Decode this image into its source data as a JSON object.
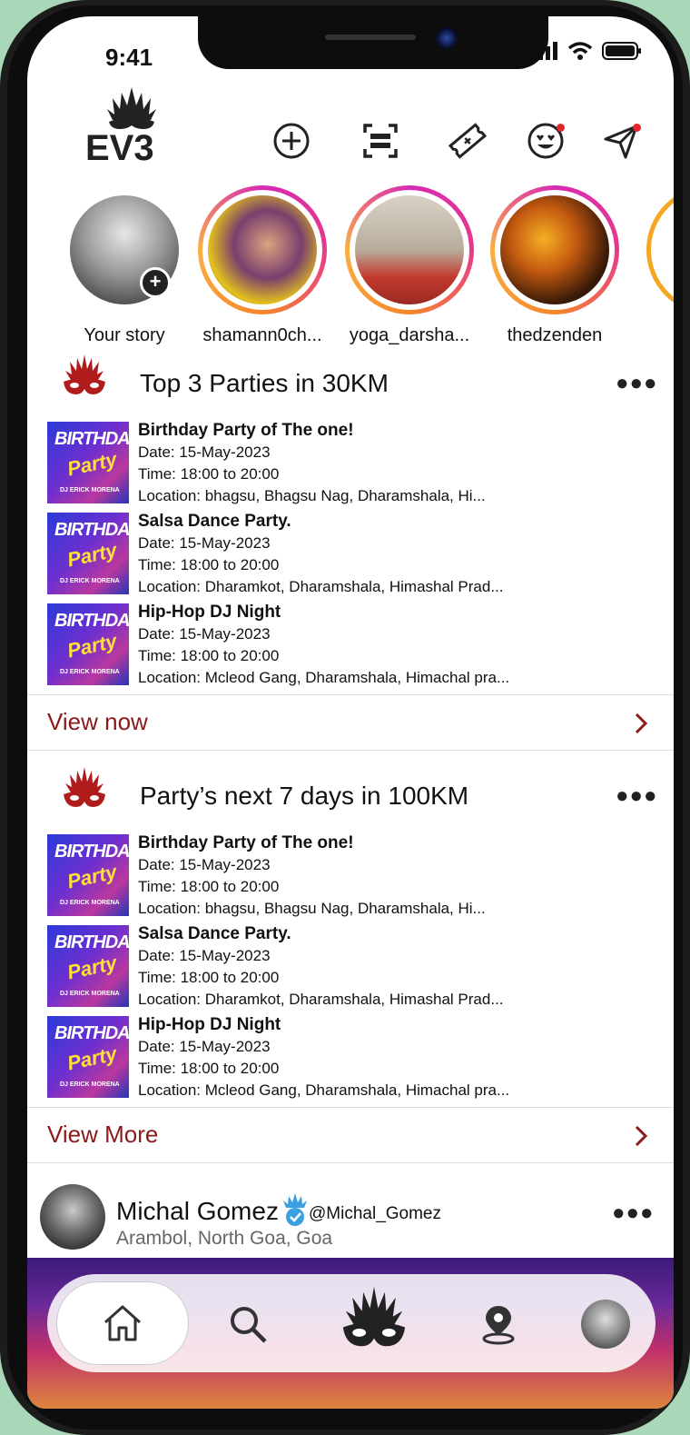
{
  "status": {
    "time": "9:41"
  },
  "app": {
    "logo_text": "EV3"
  },
  "stories": [
    {
      "label": "Your story",
      "is_own": true
    },
    {
      "label": "shamann0ch..."
    },
    {
      "label": "yoga_darsha..."
    },
    {
      "label": "thedzenden"
    }
  ],
  "sections": [
    {
      "title": "Top 3 Parties in 30KM",
      "events": [
        {
          "title": "Birthday Party of The one!",
          "date": "Date: 15-May-2023",
          "time": "Time: 18:00 to 20:00",
          "location": "Location: bhagsu, Bhagsu Nag, Dharamshala, Hi..."
        },
        {
          "title": "Salsa Dance Party.",
          "date": "Date: 15-May-2023",
          "time": "Time: 18:00 to 20:00",
          "location": "Location: Dharamkot, Dharamshala, Himashal Prad..."
        },
        {
          "title": "Hip-Hop DJ Night",
          "date": "Date: 15-May-2023",
          "time": "Time: 18:00 to 20:00",
          "location": "Location: Mcleod Gang, Dharamshala, Himachal pra..."
        }
      ],
      "action_label": "View now"
    },
    {
      "title": "Party’s next 7 days in 100KM",
      "events": [
        {
          "title": "Birthday Party of The one!",
          "date": "Date: 15-May-2023",
          "time": "Time: 18:00 to 20:00",
          "location": "Location: bhagsu, Bhagsu Nag, Dharamshala, Hi..."
        },
        {
          "title": "Salsa Dance Party.",
          "date": "Date: 15-May-2023",
          "time": "Time: 18:00 to 20:00",
          "location": "Location: Dharamkot, Dharamshala, Himashal Prad..."
        },
        {
          "title": "Hip-Hop DJ Night",
          "date": "Date: 15-May-2023",
          "time": "Time: 18:00 to 20:00",
          "location": "Location: Mcleod Gang, Dharamshala, Himachal pra..."
        }
      ],
      "action_label": "View More"
    }
  ],
  "flyer": {
    "line1": "BIRTHDAY",
    "line2": "Party",
    "line3": "DJ ERICK MORENA"
  },
  "post": {
    "name": "Michal Gomez",
    "handle": "@Michal_Gomez",
    "location": "Arambol, North Goa, Goa"
  },
  "colors": {
    "accent": "#8b1a1a",
    "notification": "#e0262b",
    "story_ring_start": "#d62ab4",
    "story_ring_end": "#fcaf45"
  },
  "icons": {
    "header": [
      "add-icon",
      "scan-icon",
      "ticket-icon",
      "heart-eyes-icon",
      "send-icon"
    ],
    "nav": [
      "home-icon",
      "search-icon",
      "mask-logo-icon",
      "map-pin-icon",
      "profile-avatar"
    ]
  }
}
